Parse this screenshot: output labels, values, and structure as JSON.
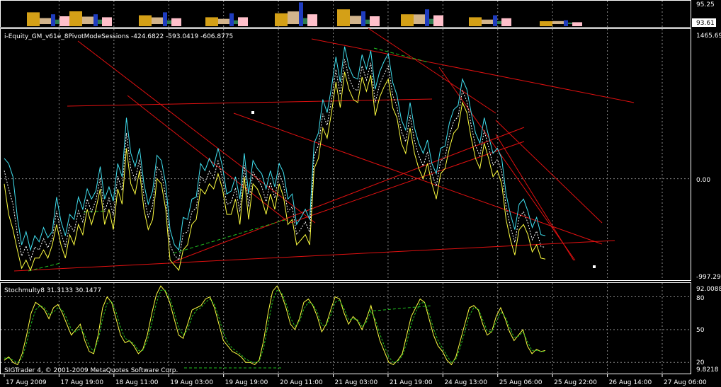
{
  "chart_data": [
    {
      "type": "bar",
      "panel": "top-histogram",
      "right_axis": {
        "top_label": "95.25",
        "current_label": "93.61"
      },
      "colors": {
        "bar_gold": "#d4a017",
        "bar_tan": "#d2b48c",
        "bar_pink": "#ffc0cb",
        "bar_blue": "#1f3cbf",
        "bar_green": "#2e7d4f"
      },
      "groups": [
        {
          "values": [
            14,
            8,
            12,
            6,
            10
          ]
        },
        {
          "values": [
            15,
            10,
            12,
            6,
            9
          ]
        },
        {
          "values": [
            11,
            9,
            14,
            5,
            8
          ]
        },
        {
          "values": [
            9,
            7,
            13,
            5,
            9
          ]
        },
        {
          "values": [
            13,
            17,
            24,
            8,
            12
          ]
        },
        {
          "values": [
            17,
            11,
            15,
            6,
            10
          ]
        },
        {
          "values": [
            12,
            13,
            17,
            7,
            11
          ]
        },
        {
          "values": [
            9,
            6,
            11,
            4,
            8
          ]
        },
        {
          "values": [
            5,
            4,
            6,
            2,
            4
          ]
        }
      ]
    },
    {
      "type": "line",
      "panel": "equity",
      "title": "i-Equity_GM_v61e_8PivotModeSessions -424.6822 -593.0419 -606.8775",
      "y_labels": [
        "1465.69",
        "0.00",
        "-997.297"
      ],
      "ylim": [
        -997.297,
        1465.69
      ],
      "colors": {
        "upper": "#40e0f0",
        "lower": "#ffff40",
        "mid": "#ffffff",
        "trend": "#e01010",
        "dashed": "#20c020"
      },
      "series": [
        {
          "values": [
            200,
            150,
            20,
            -380,
            -650,
            -520,
            -700,
            -560,
            -620,
            -480,
            -580,
            -520,
            -180,
            -420,
            -560,
            -350,
            -400,
            -180,
            -300,
            -100,
            -200,
            -120,
            120,
            -200,
            -80,
            -220,
            150,
            20,
            600,
            250,
            120,
            300,
            -50,
            -250,
            -120,
            230,
            180,
            -50,
            -500,
            -650,
            -700,
            -380,
            -400,
            -200,
            -180,
            150,
            80,
            200,
            120,
            300,
            120,
            -150,
            -120,
            20,
            -200,
            250,
            -150,
            180,
            100,
            50,
            -100,
            80,
            -80,
            150,
            60,
            -200,
            -150,
            -450,
            -380,
            -300,
            -400,
            350,
            450,
            780,
            650,
            900,
            1200,
            950,
            1300,
            1100,
            1000,
            980,
            1220,
            1080,
            1260,
            880,
            1050,
            1150,
            1230,
            950,
            820,
            580,
            480,
            750,
            500,
            350,
            250,
            380,
            150,
            50,
            300,
            320,
            550,
            680,
            720,
            980,
            880,
            650,
            450,
            350,
            600,
            420,
            250,
            300,
            200,
            -150,
            -350,
            -500,
            -250,
            -200,
            -320,
            -480,
            -380,
            -550,
            -560
          ]
        },
        {
          "values": [
            -50,
            -350,
            -500,
            -700,
            -880,
            -800,
            -900,
            -780,
            -780,
            -700,
            -780,
            -650,
            -450,
            -650,
            -780,
            -550,
            -650,
            -450,
            -550,
            -300,
            -450,
            -300,
            -100,
            -450,
            -300,
            -500,
            -100,
            -250,
            300,
            -50,
            -150,
            80,
            -300,
            -500,
            -400,
            0,
            -50,
            -300,
            -800,
            -850,
            -900,
            -700,
            -650,
            -450,
            -400,
            -100,
            -150,
            -50,
            -100,
            50,
            -100,
            -350,
            -350,
            -200,
            -450,
            20,
            -400,
            -50,
            -100,
            -200,
            -350,
            -150,
            -300,
            -50,
            -180,
            -450,
            -400,
            -650,
            -600,
            -550,
            -650,
            100,
            200,
            500,
            400,
            650,
            950,
            700,
            1050,
            880,
            780,
            750,
            1000,
            860,
            1020,
            620,
            800,
            900,
            980,
            700,
            600,
            350,
            250,
            500,
            250,
            100,
            0,
            150,
            -50,
            -200,
            50,
            100,
            300,
            450,
            500,
            750,
            650,
            400,
            200,
            100,
            350,
            200,
            20,
            80,
            -50,
            -400,
            -600,
            -750,
            -500,
            -450,
            -550,
            -720,
            -650,
            -780,
            -790
          ]
        },
        {
          "values": [
            80,
            -100,
            -250,
            -540,
            -760,
            -660,
            -800,
            -670,
            -700,
            -590,
            -680,
            -585,
            -315,
            -535,
            -670,
            -450,
            -525,
            -315,
            -425,
            -200,
            -325,
            -210,
            10,
            -325,
            -190,
            -360,
            25,
            -115,
            450,
            100,
            -15,
            190,
            -175,
            -375,
            -260,
            115,
            65,
            -175,
            -650,
            -750,
            -800,
            -540,
            -525,
            -325,
            -290,
            25,
            -35,
            75,
            10,
            175,
            10,
            -250,
            -235,
            -90,
            -325,
            135,
            -275,
            65,
            0,
            -75,
            -225,
            -35,
            -190,
            50,
            -60,
            -325,
            -275,
            -550,
            -490,
            -425,
            -525,
            225,
            325,
            640,
            525,
            775,
            1075,
            825,
            1175,
            990,
            890,
            865,
            1110,
            970,
            1140,
            750,
            925,
            1025,
            1105,
            825,
            710,
            465,
            365,
            625,
            375,
            225,
            125,
            265,
            50,
            -75,
            175,
            210,
            425,
            565,
            610,
            865,
            765,
            525,
            325,
            225,
            475,
            310,
            135,
            190,
            75,
            -275,
            -475,
            -625,
            -375,
            -325,
            -435,
            -600,
            -515,
            -665,
            -675
          ]
        }
      ]
    },
    {
      "type": "line",
      "panel": "stochastic",
      "title": "Stochmulty8 31.3133 30.1477",
      "y_labels": [
        "92.0088",
        "80",
        "50",
        "20",
        "9.8218"
      ],
      "ylim": [
        9.8218,
        92.0088
      ],
      "gridlines": [
        80,
        50,
        20
      ],
      "colors": {
        "main": "#ffff40",
        "signal": "#20c020"
      },
      "series": [
        {
          "values": [
            22,
            25,
            20,
            18,
            28,
            45,
            65,
            75,
            72,
            68,
            60,
            70,
            73,
            65,
            55,
            45,
            50,
            55,
            40,
            30,
            28,
            45,
            70,
            80,
            75,
            60,
            45,
            38,
            40,
            35,
            28,
            32,
            45,
            65,
            82,
            90,
            85,
            75,
            60,
            45,
            42,
            55,
            68,
            70,
            72,
            78,
            80,
            70,
            55,
            40,
            35,
            30,
            28,
            25,
            20,
            20,
            18,
            22,
            40,
            65,
            85,
            90,
            82,
            70,
            55,
            50,
            60,
            75,
            78,
            72,
            62,
            48,
            55,
            68,
            80,
            78,
            65,
            55,
            62,
            58,
            50,
            60,
            72,
            55,
            40,
            30,
            20,
            18,
            22,
            28,
            45,
            62,
            70,
            78,
            75,
            60,
            45,
            35,
            30,
            22,
            18,
            25,
            40,
            55,
            70,
            72,
            68,
            55,
            45,
            48,
            62,
            70,
            60,
            48,
            40,
            45,
            50,
            35,
            28,
            32,
            30,
            31
          ]
        },
        {
          "values": [
            24,
            24,
            22,
            20,
            24,
            38,
            55,
            68,
            72,
            70,
            64,
            66,
            70,
            68,
            60,
            50,
            48,
            52,
            45,
            35,
            30,
            40,
            60,
            74,
            76,
            66,
            52,
            42,
            40,
            37,
            31,
            31,
            40,
            56,
            74,
            86,
            86,
            79,
            66,
            52,
            45,
            50,
            62,
            68,
            70,
            75,
            78,
            73,
            61,
            47,
            38,
            33,
            30,
            27,
            23,
            21,
            20,
            21,
            33,
            55,
            76,
            86,
            84,
            74,
            61,
            53,
            57,
            69,
            75,
            73,
            66,
            54,
            54,
            63,
            75,
            77,
            69,
            59,
            60,
            59,
            53,
            57,
            67,
            59,
            46,
            35,
            25,
            20,
            21,
            26,
            38,
            55,
            66,
            74,
            75,
            65,
            51,
            40,
            33,
            26,
            20,
            23,
            34,
            48,
            63,
            70,
            69,
            59,
            49,
            48,
            57,
            66,
            62,
            52,
            43,
            44,
            48,
            39,
            31,
            31,
            30,
            30
          ]
        }
      ]
    }
  ],
  "top_panel": {
    "top_label": "95.25",
    "current_label": "93.61"
  },
  "equity_panel": {
    "title": "i-Equity_GM_v61e_8PivotModeSessions -424.6822 -593.0419 -606.8775",
    "label_top": "1465.69",
    "label_zero": "0.00",
    "label_bottom": "-997.297"
  },
  "stoch_panel": {
    "title": "Stochmulty8 31.3133 30.1477",
    "label_top": "92.0088",
    "label_80": "80",
    "label_50": "50",
    "label_20": "20",
    "label_bottom": "9.8218",
    "copyright": "SIGTrader 4, © 2001-2009 MetaQuotes Software Corp."
  },
  "x_axis": {
    "labels": [
      "17 Aug 2009",
      "17 Aug 19:00",
      "18 Aug 11:00",
      "19 Aug 03:00",
      "19 Aug 19:00",
      "20 Aug 11:00",
      "21 Aug 03:00",
      "21 Aug 19:00",
      "24 Aug 13:00",
      "25 Aug 06:00",
      "25 Aug 22:00",
      "26 Aug 14:00",
      "27 Aug 06:00"
    ]
  }
}
